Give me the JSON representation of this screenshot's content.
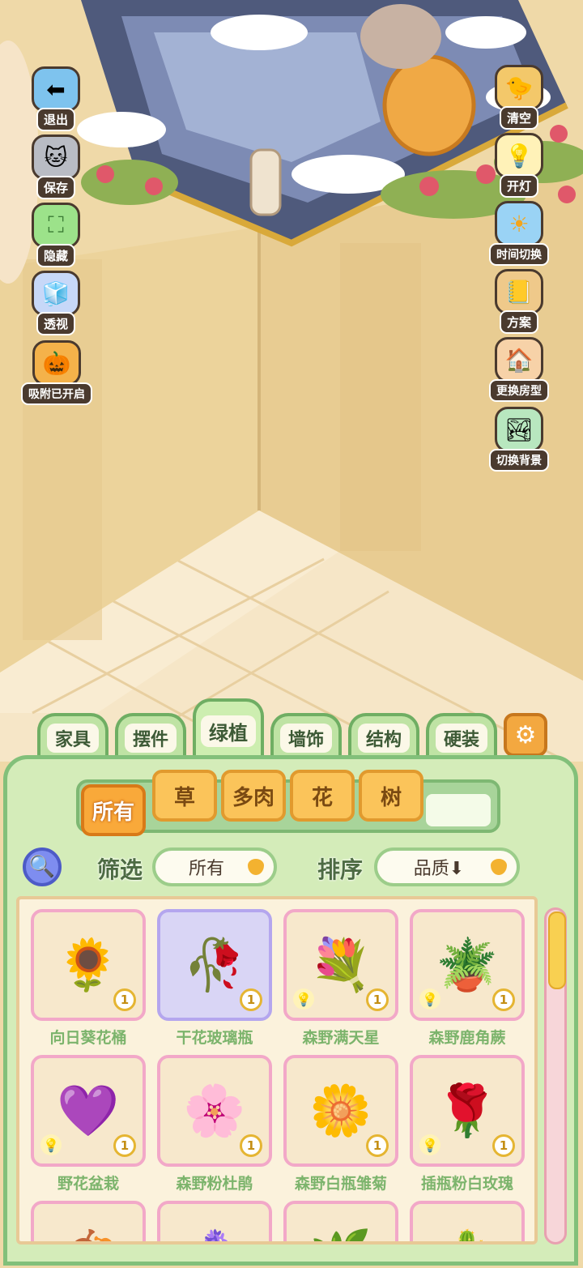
{
  "left_tools": [
    {
      "label": "退出",
      "icon": "exit-icon",
      "glyph": "⬅"
    },
    {
      "label": "保存",
      "icon": "save-icon",
      "glyph": "🐱"
    },
    {
      "label": "隐藏",
      "icon": "hide-icon",
      "glyph": "⛶"
    },
    {
      "label": "透视",
      "icon": "perspective-icon",
      "glyph": "🧊"
    },
    {
      "label": "吸附已开启",
      "icon": "snap-icon",
      "glyph": "🎃"
    }
  ],
  "right_tools": [
    {
      "label": "清空",
      "icon": "clear-icon",
      "glyph": "🐤"
    },
    {
      "label": "开灯",
      "icon": "light-icon",
      "glyph": "💡"
    },
    {
      "label": "时间切换",
      "icon": "time-switch-icon",
      "glyph": "☀"
    },
    {
      "label": "方案",
      "icon": "plan-icon",
      "glyph": "📒"
    },
    {
      "label": "更换房型",
      "icon": "house-icon",
      "glyph": "🏠"
    },
    {
      "label": "切换背景",
      "icon": "background-icon",
      "glyph": "🏞"
    }
  ],
  "tabs": [
    {
      "label": "家具",
      "active": false
    },
    {
      "label": "摆件",
      "active": false
    },
    {
      "label": "绿植",
      "active": true
    },
    {
      "label": "墙饰",
      "active": false
    },
    {
      "label": "结构",
      "active": false
    },
    {
      "label": "硬装",
      "active": false
    }
  ],
  "settings_icon": "gear-icon",
  "subtabs": [
    {
      "label": "所有",
      "active": true
    },
    {
      "label": "草",
      "active": false
    },
    {
      "label": "多肉",
      "active": false
    },
    {
      "label": "花",
      "active": false
    },
    {
      "label": "树",
      "active": false
    }
  ],
  "filter": {
    "label": "筛选",
    "value": "所有"
  },
  "sort": {
    "label": "排序",
    "value": "品质⬇"
  },
  "items": [
    {
      "name": "向日葵花桶",
      "count": "1",
      "bulb": false,
      "glyph": "🌻",
      "bg": "peach"
    },
    {
      "name": "干花玻璃瓶",
      "count": "1",
      "bulb": false,
      "glyph": "🥀",
      "bg": "purple"
    },
    {
      "name": "森野满天星",
      "count": "1",
      "bulb": true,
      "glyph": "💐",
      "bg": "peach"
    },
    {
      "name": "森野鹿角蕨",
      "count": "1",
      "bulb": true,
      "glyph": "🪴",
      "bg": "peach"
    },
    {
      "name": "野花盆栽",
      "count": "1",
      "bulb": true,
      "glyph": "💜",
      "bg": "peach"
    },
    {
      "name": "森野粉杜鹃",
      "count": "1",
      "bulb": false,
      "glyph": "🌸",
      "bg": "peach"
    },
    {
      "name": "森野白瓶雏菊",
      "count": "1",
      "bulb": false,
      "glyph": "🌼",
      "bg": "peach"
    },
    {
      "name": "插瓶粉白玫瑰",
      "count": "1",
      "bulb": true,
      "glyph": "🌹",
      "bg": "peach"
    },
    {
      "name": "",
      "count": "",
      "bulb": false,
      "glyph": "🍂",
      "bg": "peach"
    },
    {
      "name": "",
      "count": "",
      "bulb": false,
      "glyph": "🪻",
      "bg": "peach"
    },
    {
      "name": "",
      "count": "",
      "bulb": false,
      "glyph": "🌿",
      "bg": "peach"
    },
    {
      "name": "",
      "count": "",
      "bulb": false,
      "glyph": "🌵",
      "bg": "peach"
    }
  ],
  "colors": {
    "panel": "#d4ecb9",
    "accent_orange": "#f9a93a",
    "tab_green": "#6fae63"
  }
}
